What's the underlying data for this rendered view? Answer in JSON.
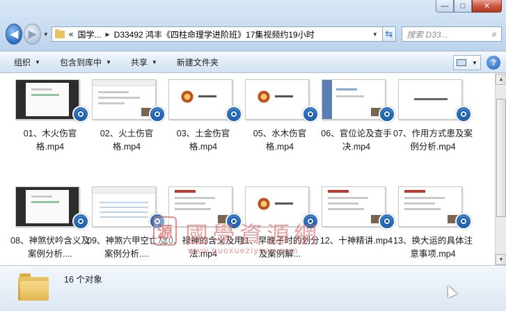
{
  "window": {
    "buttons": {
      "minimize": "—",
      "maximize": "□",
      "close": "✕"
    }
  },
  "nav": {
    "back_icon": "◀",
    "forward_icon": "▶",
    "breadcrumb": [
      "«",
      "国学...",
      "D33492 鸿丰《四柱命理学进阶班》17集视频约19小时"
    ],
    "search_placeholder": "搜索 D33..."
  },
  "toolbar": {
    "organize": "组织",
    "include_in_library": "包含到库中",
    "share": "共享",
    "new_folder": "新建文件夹"
  },
  "files": [
    {
      "name": "01、木火伤官格.mp4",
      "thumb": "dark"
    },
    {
      "name": "02、火土伤官格.mp4",
      "thumb": "slide"
    },
    {
      "name": "03、土金伤官格.mp4",
      "thumb": "seal"
    },
    {
      "name": "05、水木伤官格.mp4",
      "thumb": "seal"
    },
    {
      "name": "06、官位论及查手决.mp4",
      "thumb": "ui"
    },
    {
      "name": "07、作用方式患及案例分析.mp4",
      "thumb": "text"
    },
    {
      "name": "08、神煞伏吟含义及案例分析....",
      "thumb": "dark"
    },
    {
      "name": "09、神煞六甲空亡及案例分析....",
      "thumb": "grid"
    },
    {
      "name": "10、禄神的含义及用法.mp4",
      "thumb": "redtitle"
    },
    {
      "name": "11、早晚子时的划分及案例解...",
      "thumb": "seal"
    },
    {
      "name": "12、十神精讲.mp4",
      "thumb": "redtitle"
    },
    {
      "name": "13、换大运的具体注意事项.mp4",
      "thumb": "redtitle"
    }
  ],
  "watermark": {
    "seal": "源",
    "title": "國學資源網",
    "url": "www.guoxueziyuan.com"
  },
  "status": {
    "count": "16 个对象"
  }
}
